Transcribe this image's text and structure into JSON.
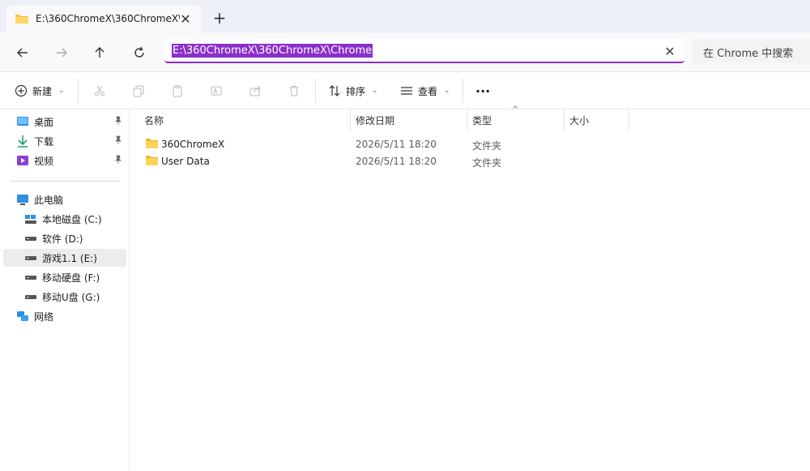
{
  "tab": {
    "title": "E:\\360ChromeX\\360ChromeX\\",
    "close": "✕",
    "new_tab": "+"
  },
  "nav": {
    "address": "E:\\360ChromeX\\360ChromeX\\Chrome",
    "clear": "✕",
    "search_placeholder": "在 Chrome 中搜索"
  },
  "toolbar": {
    "new_label": "新建",
    "sort_label": "排序",
    "view_label": "查看",
    "more": "···"
  },
  "sidebar": {
    "quick": [
      {
        "label": "桌面"
      },
      {
        "label": "下载"
      },
      {
        "label": "视频"
      }
    ],
    "pc_label": "此电脑",
    "drives": [
      {
        "label": "本地磁盘 (C:)"
      },
      {
        "label": "软件 (D:)"
      },
      {
        "label": "游戏1.1 (E:)"
      },
      {
        "label": "移动硬盘 (F:)"
      },
      {
        "label": "移动U盘 (G:)"
      }
    ],
    "network_label": "网络"
  },
  "columns": {
    "name": "名称",
    "modified": "修改日期",
    "type": "类型",
    "size": "大小"
  },
  "files": [
    {
      "name": "360ChromeX",
      "modified": "2026/5/11 18:20",
      "type": "文件夹"
    },
    {
      "name": "User Data",
      "modified": "2026/5/11 18:20",
      "type": "文件夹"
    }
  ],
  "colors": {
    "accent": "#8b2fc9",
    "folder": "#f4c542"
  }
}
